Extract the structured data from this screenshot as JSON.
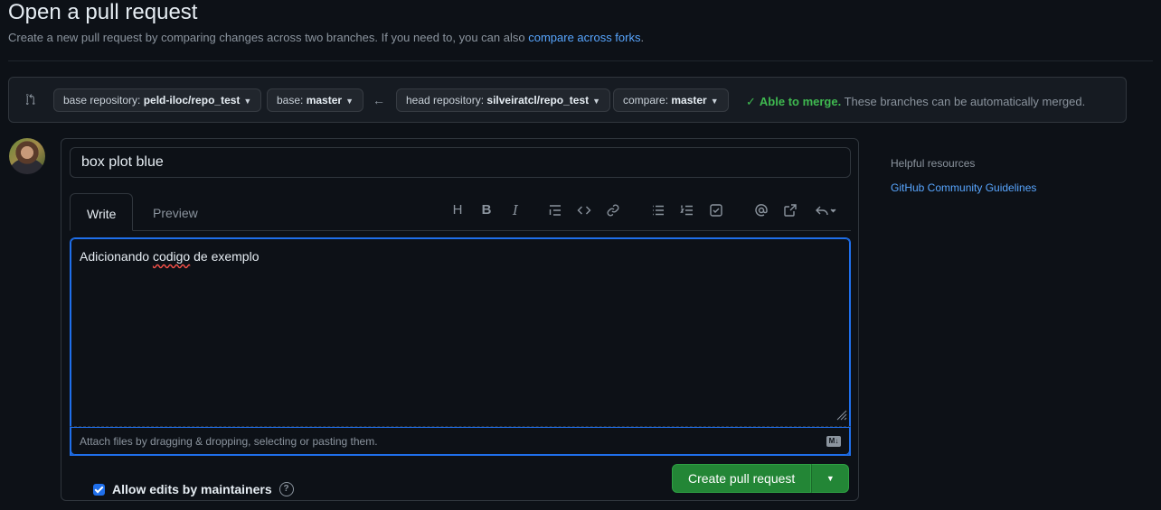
{
  "header": {
    "title": "Open a pull request",
    "subtitle_prefix": "Create a new pull request by comparing changes across two branches. If you need to, you can also ",
    "subtitle_link": "compare across forks",
    "subtitle_suffix": "."
  },
  "range": {
    "base_repo_label": "base repository: ",
    "base_repo_value": "peld-iloc/repo_test",
    "base_label": "base: ",
    "base_value": "master",
    "head_repo_label": "head repository: ",
    "head_repo_value": "silveiratcl/repo_test",
    "compare_label": "compare: ",
    "compare_value": "master",
    "merge_ok": "Able to merge.",
    "merge_message": " These branches can be automatically merged."
  },
  "form": {
    "title_value": "box plot blue",
    "tabs": [
      {
        "label": "Write"
      },
      {
        "label": "Preview"
      }
    ],
    "toolbar_icons": [
      "heading-icon",
      "bold-icon",
      "italic-icon",
      "quote-icon",
      "code-icon",
      "link-icon",
      "unordered-list-icon",
      "ordered-list-icon",
      "task-list-icon",
      "mention-icon",
      "reference-icon",
      "reply-icon"
    ],
    "toolbar_text": {
      "heading": "H",
      "bold": "B",
      "italic": "I"
    },
    "body_before": "Adicionando ",
    "body_misspelled": "codigo",
    "body_after": " de exemplo",
    "attach_hint": "Attach files by dragging & dropping, selecting or pasting them.",
    "allow_edits_label": "Allow edits by maintainers",
    "allow_edits_checked": true,
    "help_glyph": "?",
    "create_label": "Create pull request"
  },
  "sidebar": {
    "helpful_title": "Helpful resources",
    "guidelines_link": "GitHub Community Guidelines"
  },
  "colors": {
    "accent": "#1f6feb",
    "success": "#3fb950",
    "button_green": "#238636",
    "link": "#58a6ff"
  }
}
